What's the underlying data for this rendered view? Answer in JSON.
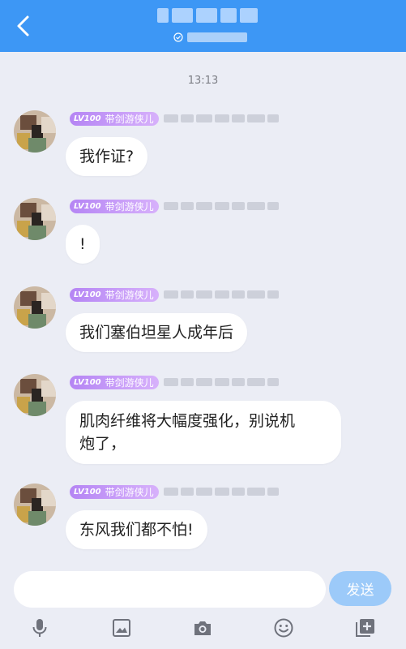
{
  "header": {
    "back_icon": "chevron-left-icon"
  },
  "timestamp": "13:13",
  "messages": [
    {
      "level": "LV100",
      "title": "带剑游侠儿",
      "text": "我作证?"
    },
    {
      "level": "LV100",
      "title": "带剑游侠儿",
      "text": "!"
    },
    {
      "level": "LV100",
      "title": "带剑游侠儿",
      "text": "我们塞伯坦星人成年后"
    },
    {
      "level": "LV100",
      "title": "带剑游侠儿",
      "text_line1": "肌肉纤维将大幅度强化，别说机",
      "text_line2": "炮了，"
    },
    {
      "level": "LV100",
      "title": "带剑游侠儿",
      "text": "东风我们都不怕!"
    }
  ],
  "input": {
    "placeholder": "",
    "send_label": "发送"
  },
  "toolbar": [
    "microphone-icon",
    "image-icon",
    "camera-icon",
    "emoji-icon",
    "add-icon"
  ],
  "colors": {
    "header": "#3d97f5",
    "background": "#ebedf5",
    "send_button": "#9ccaf9",
    "badge": "#b585f4"
  }
}
